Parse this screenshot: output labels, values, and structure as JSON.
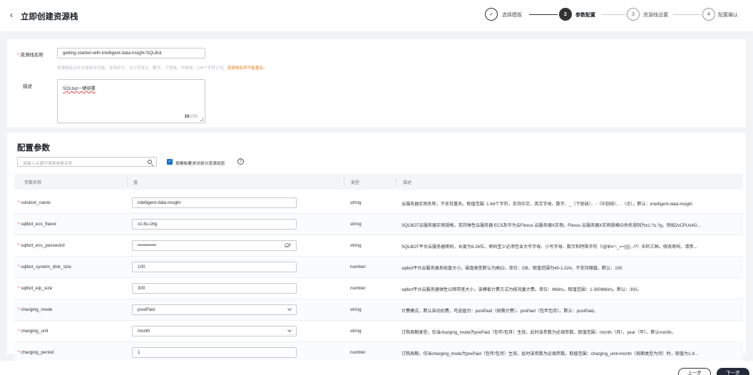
{
  "header": {
    "back_icon": "‹",
    "title": "立即创建资源栈",
    "steps": [
      {
        "number": "✓",
        "label": "选择模板"
      },
      {
        "number": "2",
        "label": "参数配置"
      },
      {
        "number": "3",
        "label": "资源栈设置"
      },
      {
        "number": "4",
        "label": "配置确认"
      }
    ]
  },
  "stack": {
    "name_label": "资源栈名称",
    "name_value": "getting-started-with-intelligent-data-insight-SQLBot",
    "name_hint": "资源栈名以中文或英文开始，支持中文、大小写英文、数字、下划线、中划线，128个字符之内。",
    "name_warning": "资源栈名称不能重名。",
    "desc_label": "描述",
    "desc_value": "SQLbot一键部署",
    "desc_count": "10",
    "desc_max": "/255"
  },
  "params": {
    "section_title": "配置参数",
    "search_placeholder": "请输入关键字搜索参数名称",
    "encrypt_label": "按模板要求对部分资源加密",
    "help_icon": "?",
    "columns": {
      "name": "参数名称",
      "value": "值",
      "type": "类型",
      "desc": "描述"
    },
    "rows": [
      {
        "name": "solution_name",
        "value": "intelligent-data-insight",
        "type": "string",
        "desc": "云服务器实例名称，不支持重名。取值范围: 1-64个字符，支持中文、英文字母、数字、_（下划线）、-（中划线）、.（点）。默认：intelligent-data-insight"
      },
      {
        "name": "sqlbot_ecs_flavor",
        "value": "x1.8u.16g",
        "type": "string",
        "desc": "SQLBOT云服务器实例规格，支持弹性云服务器 ECS及华为云Flexus 云服务器X实例。Flexus 云服务器X实例规格ID命名规则为x1.?u.?g，例如2vCPUs4G..."
      },
      {
        "name": "sqlbot_ecs_password",
        "value": "••••••••••••",
        "type": "string",
        "desc": "SQLBOT平台云服务器密码，长度为8-26位，密码至少必须包含大写字母、小写字母、数字和特殊字符（!@$%^-_=+[{}]:,./?）中的三种。修改密码，请参..."
      },
      {
        "name": "sqlbot_system_disk_size",
        "value": "100",
        "type": "number",
        "desc": "sqlbot平台云服务器系统盘大小，磁盘类型默认为高IO，单位：GB，取值范围为40-1,024，不支持缩盘。默认：100"
      },
      {
        "name": "sqlbot_eip_size",
        "value": "300",
        "type": "number",
        "desc": "sqlbot平台云服务器弹性公网带宽大小，该模板计费方式为按流量计费。单位：Mbit/s，取值范围：1-300Mbit/s。默认：300。"
      },
      {
        "name": "charging_mode",
        "value": "postPaid",
        "type": "string",
        "desc": "计费模式，默认自动扣费，可选值为：postPaid（按需计费）、prePaid（包年包月）。默认：postPaid。"
      },
      {
        "name": "charging_unit",
        "value": "month",
        "type": "string",
        "desc": "订购周期类型，仅当charging_mode为prePaid（包年/包月）生效，此时该参数为必填参数。取值范围：month（月），year（年）。默认month。"
      },
      {
        "name": "charging_period",
        "value": "1",
        "type": "number",
        "desc": "订购周期，仅当charging_mode为prePaid（包年/包月）生效，此时该参数为必填参数。取值范围：charging_unit=month（周期类型为月）时，取值为1-9..."
      }
    ]
  },
  "footer": {
    "prev": "上一步",
    "next": "下一步"
  }
}
